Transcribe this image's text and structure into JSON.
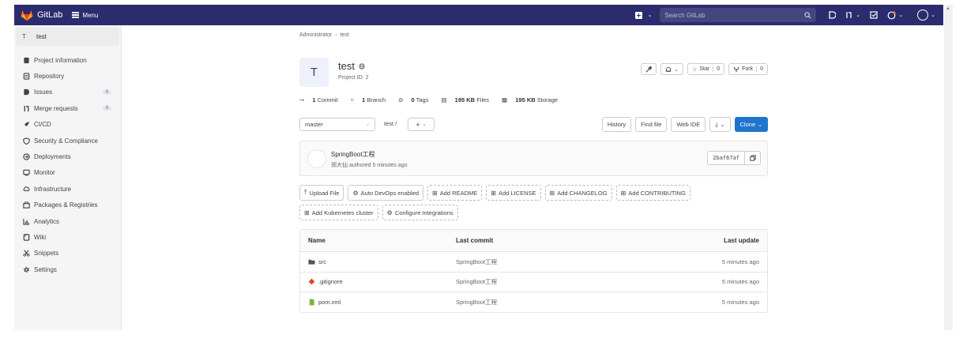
{
  "navbar": {
    "brand": "GitLab",
    "menu_label": "Menu",
    "search_placeholder": "Search GitLab",
    "colors": {
      "background": "#2b2b6e",
      "search_bg": "#45457f"
    }
  },
  "sidebar": {
    "project_initial": "T",
    "project_name": "test",
    "items": [
      {
        "label": "Project information",
        "icon": "info-doc-icon"
      },
      {
        "label": "Repository",
        "icon": "repository-icon"
      },
      {
        "label": "Issues",
        "icon": "issues-icon",
        "count": "0"
      },
      {
        "label": "Merge requests",
        "icon": "merge-request-icon",
        "count": "0"
      },
      {
        "label": "CI/CD",
        "icon": "rocket-icon"
      },
      {
        "label": "Security & Compliance",
        "icon": "shield-icon"
      },
      {
        "label": "Deployments",
        "icon": "deployments-icon"
      },
      {
        "label": "Monitor",
        "icon": "monitor-icon"
      },
      {
        "label": "Infrastructure",
        "icon": "cloud-icon"
      },
      {
        "label": "Packages & Registries",
        "icon": "package-icon"
      },
      {
        "label": "Analytics",
        "icon": "chart-icon"
      },
      {
        "label": "Wiki",
        "icon": "book-icon"
      },
      {
        "label": "Snippets",
        "icon": "scissors-icon"
      },
      {
        "label": "Settings",
        "icon": "gear-icon"
      }
    ]
  },
  "breadcrumb": {
    "parent": "Administrator",
    "sep": "›",
    "current": "test"
  },
  "project": {
    "initial": "T",
    "name": "test",
    "id_text": "Project ID: 2",
    "star_label": "Star",
    "star_count": "0",
    "fork_label": "Fork",
    "fork_count": "0"
  },
  "stats": {
    "commits_num": "1",
    "commits_label": "Commit",
    "branches_num": "1",
    "branches_label": "Branch",
    "tags_num": "0",
    "tags_label": "Tags",
    "files_size": "195 KB",
    "files_label": "Files",
    "storage_size": "195 KB",
    "storage_label": "Storage"
  },
  "toolbar": {
    "branch": "master",
    "path": "test /",
    "history": "History",
    "find_file": "Find file",
    "web_ide": "Web IDE",
    "clone": "Clone",
    "primary_color": "#1f75cb"
  },
  "last_commit": {
    "title": "SpringBoot工程",
    "meta": "郑大仙 authored 5 minutes ago",
    "sha": "2baf67af"
  },
  "quick_actions": {
    "upload_file": "Upload File",
    "auto_devops": "Auto DevOps enabled",
    "add_readme": "Add README",
    "add_license": "Add LICENSE",
    "add_changelog": "Add CHANGELOG",
    "add_contributing": "Add CONTRIBUTING",
    "add_k8s": "Add Kubernetes cluster",
    "configure_integrations": "Configure Integrations"
  },
  "files": {
    "headers": {
      "name": "Name",
      "last_commit": "Last commit",
      "last_update": "Last update"
    },
    "rows": [
      {
        "name": "src",
        "icon": "folder-icon",
        "commit": "SpringBoot工程",
        "updated": "5 minutes ago"
      },
      {
        "name": ".gitignore",
        "icon": "git-icon",
        "commit": "SpringBoot工程",
        "updated": "5 minutes ago"
      },
      {
        "name": "pom.xml",
        "icon": "file-icon",
        "commit": "SpringBoot工程",
        "updated": "5 minutes ago"
      }
    ]
  }
}
